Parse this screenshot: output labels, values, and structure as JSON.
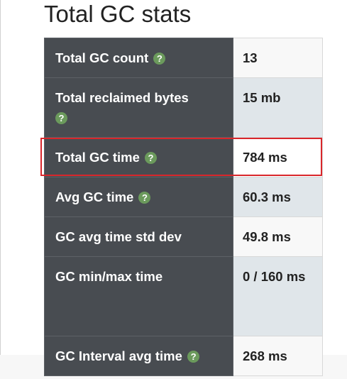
{
  "title": "Total GC stats",
  "rows": [
    {
      "label": "Total GC count",
      "value": "13",
      "help_icon": "question-circle-icon"
    },
    {
      "label": "Total reclaimed bytes",
      "value": "15 mb",
      "help_icon": "question-circle-icon"
    },
    {
      "label": "Total GC time",
      "value": "784 ms",
      "help_icon": "question-circle-icon"
    },
    {
      "label": "Avg GC time",
      "value": "60.3 ms",
      "help_icon": "question-circle-icon"
    },
    {
      "label": "GC avg time std dev",
      "value": "49.8 ms"
    },
    {
      "label": "GC min/max time",
      "value": "0 / 160 ms"
    },
    {
      "label": "GC Interval avg time",
      "value": "268 ms",
      "help_icon": "question-circle-icon"
    }
  ],
  "help_glyph": "?",
  "colors": {
    "label_bg": "#484c51",
    "value_bg": "#f8f8f8",
    "value_alt_bg": "#e0e6ea",
    "help_icon": "#6b9a5c",
    "highlight": "#d9262b"
  }
}
